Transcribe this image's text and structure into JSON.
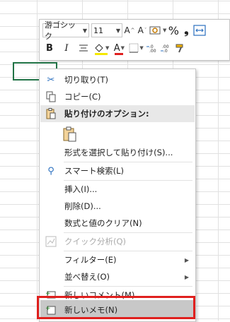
{
  "mini_toolbar": {
    "font_name": "游ゴシック",
    "font_size": "11",
    "increase_font": "A",
    "decrease_font": "A",
    "percent": "%",
    "comma": "❟",
    "bold": "B",
    "italic": "I",
    "font_color": "A",
    "font_color_hex": "#e02020",
    "fill_color_hex": "#f5e800"
  },
  "menu": {
    "cut": "切り取り(T)",
    "copy": "コピー(C)",
    "paste_options": "貼り付けのオプション:",
    "paste_special": "形式を選択して貼り付け(S)...",
    "smart_lookup": "スマート検索(L)",
    "insert": "挿入(I)...",
    "delete": "削除(D)...",
    "clear": "数式と値のクリア(N)",
    "quick_analysis": "クイック分析(Q)",
    "filter": "フィルター(E)",
    "sort": "並べ替え(O)",
    "new_comment": "新しいコメント(M)",
    "new_note": "新しいメモ(N)"
  }
}
